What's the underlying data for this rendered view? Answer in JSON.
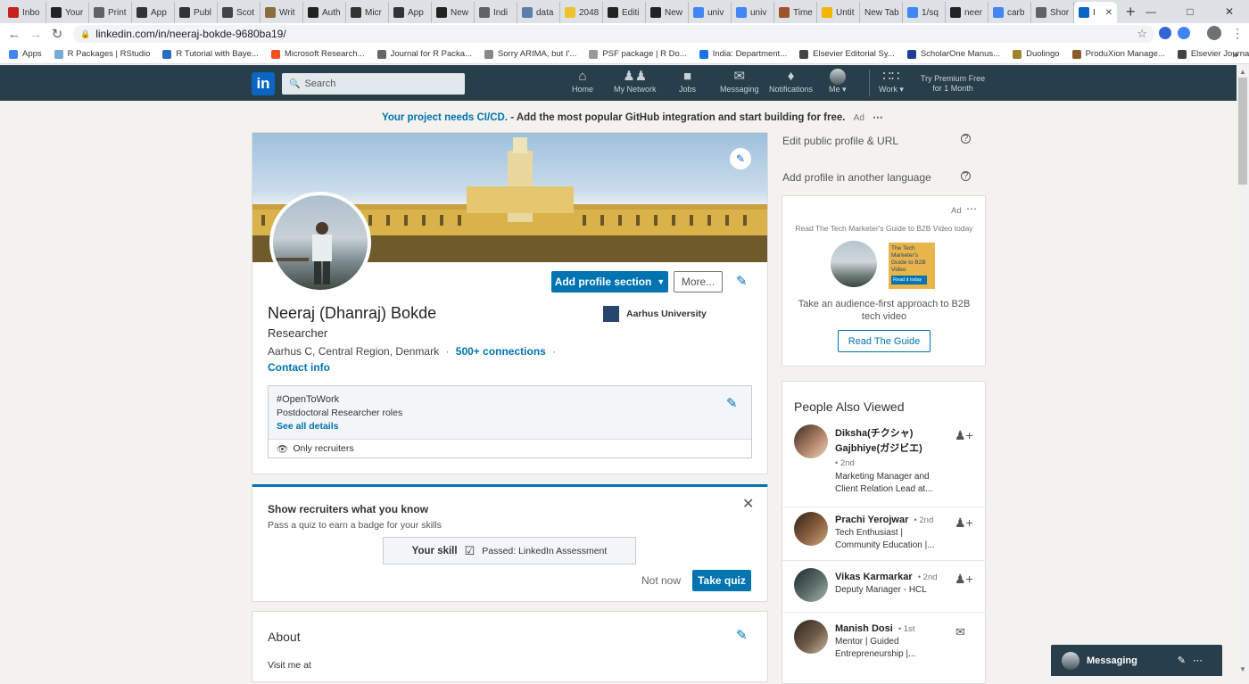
{
  "browser": {
    "tabs": [
      {
        "label": "Inbo",
        "icon": "gmail-icon",
        "color": "#c5221f"
      },
      {
        "label": "Your",
        "icon": "medium-icon",
        "color": "#222222"
      },
      {
        "label": "Print",
        "icon": "site-icon",
        "color": "#5f6368"
      },
      {
        "label": "App",
        "icon": "p-icon",
        "color": "#333333"
      },
      {
        "label": "Publ",
        "icon": "p-icon",
        "color": "#333333"
      },
      {
        "label": "Scot",
        "icon": "doc-icon",
        "color": "#444444"
      },
      {
        "label": "Writ",
        "icon": "t-icon",
        "color": "#8a6d3b"
      },
      {
        "label": "Auth",
        "icon": "a-icon",
        "color": "#222222"
      },
      {
        "label": "Micr",
        "icon": "m-icon",
        "color": "#333333"
      },
      {
        "label": "App",
        "icon": "p-icon",
        "color": "#333333"
      },
      {
        "label": "New",
        "icon": "m-icon",
        "color": "#222222"
      },
      {
        "label": "Indi",
        "icon": "globe-icon",
        "color": "#5f6368"
      },
      {
        "label": "data",
        "icon": "db-icon",
        "color": "#5b7fa8"
      },
      {
        "label": "2048",
        "icon": "game-icon",
        "color": "#edc22e"
      },
      {
        "label": "Editi",
        "icon": "m-icon",
        "color": "#222222"
      },
      {
        "label": "New",
        "icon": "m-icon",
        "color": "#222222"
      },
      {
        "label": "univ",
        "icon": "google-icon",
        "color": "#4285f4"
      },
      {
        "label": "univ",
        "icon": "google-icon",
        "color": "#4285f4"
      },
      {
        "label": "Time",
        "icon": "clock-icon",
        "color": "#a0522d"
      },
      {
        "label": "Untit",
        "icon": "doc-icon",
        "color": "#f4b400"
      },
      {
        "label": "New Tab",
        "icon": "",
        "color": "#dee1e6"
      },
      {
        "label": "1/sq",
        "icon": "google-icon",
        "color": "#4285f4"
      },
      {
        "label": "neer",
        "icon": "github-icon",
        "color": "#222222"
      },
      {
        "label": "carb",
        "icon": "google-icon",
        "color": "#4285f4"
      },
      {
        "label": "Shor",
        "icon": "globe-icon",
        "color": "#5f6368"
      },
      {
        "label": "I",
        "icon": "linkedin-icon",
        "color": "#0a66c2",
        "active": true
      }
    ],
    "url": "linkedin.com/in/neeraj-bokde-9680ba19/",
    "bookmarks": [
      {
        "label": "Apps",
        "color": "#4285f4"
      },
      {
        "label": "R Packages | RStudio",
        "color": "#75aadb"
      },
      {
        "label": "R Tutorial with Baye...",
        "color": "#276dc3"
      },
      {
        "label": "Microsoft Research...",
        "color": "#f25022"
      },
      {
        "label": "Journal for R Packa...",
        "color": "#666666"
      },
      {
        "label": "Sorry ARIMA, but I'...",
        "color": "#888888"
      },
      {
        "label": "PSF package | R Do...",
        "color": "#999999"
      },
      {
        "label": "India: Department...",
        "color": "#1a73e8"
      },
      {
        "label": "Elsevier Editorial Sy...",
        "color": "#444444"
      },
      {
        "label": "ScholarOne Manus...",
        "color": "#1c3f94"
      },
      {
        "label": "Duolingo",
        "color": "#a0822b"
      },
      {
        "label": "ProduXion Manage...",
        "color": "#8a5a2b"
      },
      {
        "label": "Elsevier Journal Me...",
        "color": "#444444"
      }
    ]
  },
  "header": {
    "logo": "in",
    "search_placeholder": "Search",
    "nav": {
      "home": "Home",
      "network": "My Network",
      "jobs": "Jobs",
      "messaging": "Messaging",
      "notifications": "Notifications",
      "me": "Me",
      "work": "Work"
    },
    "premium_line1": "Try Premium Free",
    "premium_line2": "for 1 Month"
  },
  "ad_banner": {
    "link": "Your project needs CI/CD.",
    "text": "- Add the most popular GitHub integration and start building for free.",
    "tag": "Ad"
  },
  "profile": {
    "name": "Neeraj (Dhanraj) Bokde",
    "headline": "Researcher",
    "location": "Aarhus C, Central Region, Denmark",
    "connections": "500+ connections",
    "contact": "Contact info",
    "school": "Aarhus University",
    "add_section": "Add profile section",
    "more": "More...",
    "open_to_work": {
      "title": "#OpenToWork",
      "roles": "Postdoctoral Researcher roles",
      "details": "See all details",
      "visibility": "Only recruiters"
    }
  },
  "quiz": {
    "title": "Show recruiters what you know",
    "subtitle": "Pass a quiz to earn a badge for your skills",
    "skill": "Your skill",
    "passed": "Passed: LinkedIn Assessment",
    "not_now": "Not now",
    "take": "Take quiz"
  },
  "about": {
    "title": "About",
    "text": "Visit me at"
  },
  "sidebar": {
    "edit_url": "Edit public profile & URL",
    "other_lang": "Add profile in another language",
    "ad": {
      "tag": "Ad",
      "headline": "Read The Tech Marketer's Guide to B2B Video today",
      "book_title": "The Tech Marketer's Guide to B2B Video",
      "book_cta": "Read it today",
      "text_line1": "Take an audience-first approach to B2B",
      "text_line2": "tech video",
      "cta": "Read The Guide"
    },
    "people_title": "People Also Viewed",
    "people": [
      {
        "name_line1": "Diksha(チクシャ)",
        "name_line2": "Gajbhiye(ガジビエ)",
        "degree": "• 2nd",
        "desc_line1": "Marketing Manager and",
        "desc_line2": "Client Relation Lead at...",
        "action": "connect"
      },
      {
        "name": "Prachi Yerojwar",
        "degree": "• 2nd",
        "desc_line1": "Tech Enthusiast |",
        "desc_line2": "Community Education |...",
        "action": "connect"
      },
      {
        "name": "Vikas Karmarkar",
        "degree": "• 2nd",
        "desc_line1": "Deputy Manager - HCL",
        "action": "connect"
      },
      {
        "name": "Manish Dosi",
        "degree": "• 1st",
        "desc_line1": "Mentor | Guided",
        "desc_line2": "Entrepreneurship |...",
        "action": "message"
      }
    ]
  },
  "messaging": {
    "label": "Messaging"
  }
}
